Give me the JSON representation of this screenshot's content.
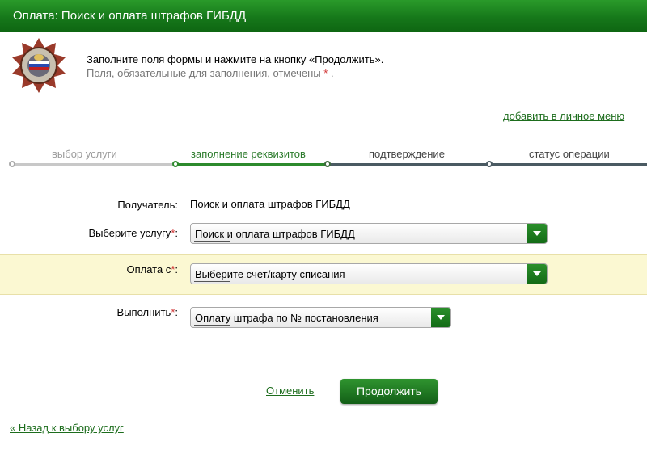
{
  "header": {
    "title": "Оплата: Поиск и оплата штрафов ГИБДД"
  },
  "logo": {
    "icon": "traffic-police-emblem-icon"
  },
  "info": {
    "line1": "Заполните поля формы и нажмите на кнопку «Продолжить».",
    "line2": "Поля, обязательные для заполнения, отмечены",
    "required_mark": "*",
    "line2_end": "."
  },
  "links": {
    "add_to_menu": "добавить в личное меню",
    "back": "« Назад к выбору услуг"
  },
  "steps": [
    {
      "label": "выбор услуги",
      "state": "done"
    },
    {
      "label": "заполнение реквизитов",
      "state": "active"
    },
    {
      "label": "подтверждение",
      "state": "pending"
    },
    {
      "label": "статус операции",
      "state": "pending"
    }
  ],
  "form": {
    "recipient": {
      "label": "Получатель:",
      "value": "Поиск и оплата штрафов ГИБДД"
    },
    "service": {
      "label": "Выберите услугу",
      "required": "*",
      "colon": ":",
      "value": "Поиск и оплата штрафов ГИБДД"
    },
    "pay_from": {
      "label": "Оплата с",
      "required": "*",
      "colon": ":",
      "value": "Выберите счет/карту списания"
    },
    "execute": {
      "label": "Выполнить",
      "required": "*",
      "colon": ":",
      "value": "Оплату штрафа по № постановления"
    }
  },
  "buttons": {
    "cancel": "Отменить",
    "continue": "Продолжить"
  },
  "colors": {
    "brand_green": "#16781a",
    "required_red": "#d03030",
    "highlight": "#fbf8d2"
  }
}
